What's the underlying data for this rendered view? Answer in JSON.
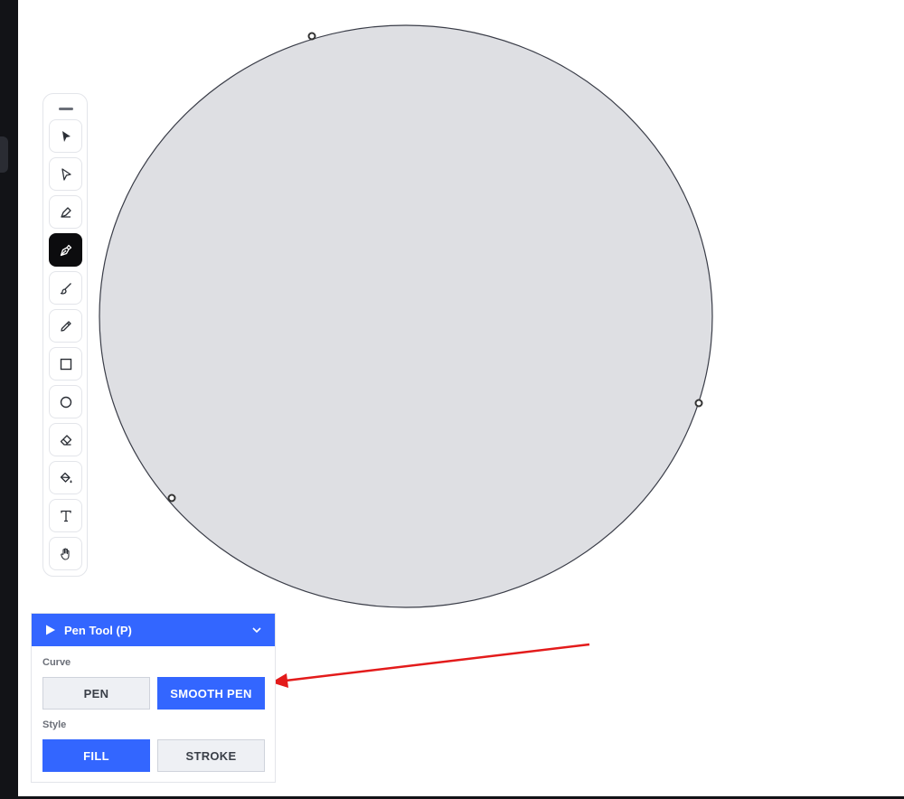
{
  "colors": {
    "accent": "#3366ff",
    "shape_fill": "#dedfe3",
    "shape_stroke": "#3a3d48",
    "annotation_arrow": "#e31b1b",
    "active_tool_bg": "#0c0c0e"
  },
  "toolbar": {
    "tools": [
      {
        "name": "select-icon",
        "active": false
      },
      {
        "name": "direct-select-icon",
        "active": false
      },
      {
        "name": "pencil-nib-icon",
        "active": false
      },
      {
        "name": "pen-tool-icon",
        "active": true
      },
      {
        "name": "brush-icon",
        "active": false
      },
      {
        "name": "pencil-icon",
        "active": false
      },
      {
        "name": "rectangle-icon",
        "active": false
      },
      {
        "name": "ellipse-icon",
        "active": false
      },
      {
        "name": "eraser-icon",
        "active": false
      },
      {
        "name": "paint-bucket-icon",
        "active": false
      },
      {
        "name": "text-icon",
        "active": false
      },
      {
        "name": "hand-icon",
        "active": false
      }
    ]
  },
  "panel": {
    "title": "Pen Tool (P)",
    "curve_label": "Curve",
    "curve_options": [
      "PEN",
      "SMOOTH PEN"
    ],
    "curve_selected": "SMOOTH PEN",
    "style_label": "Style",
    "style_options": [
      "FILL",
      "STROKE"
    ],
    "style_selected": "FILL"
  }
}
